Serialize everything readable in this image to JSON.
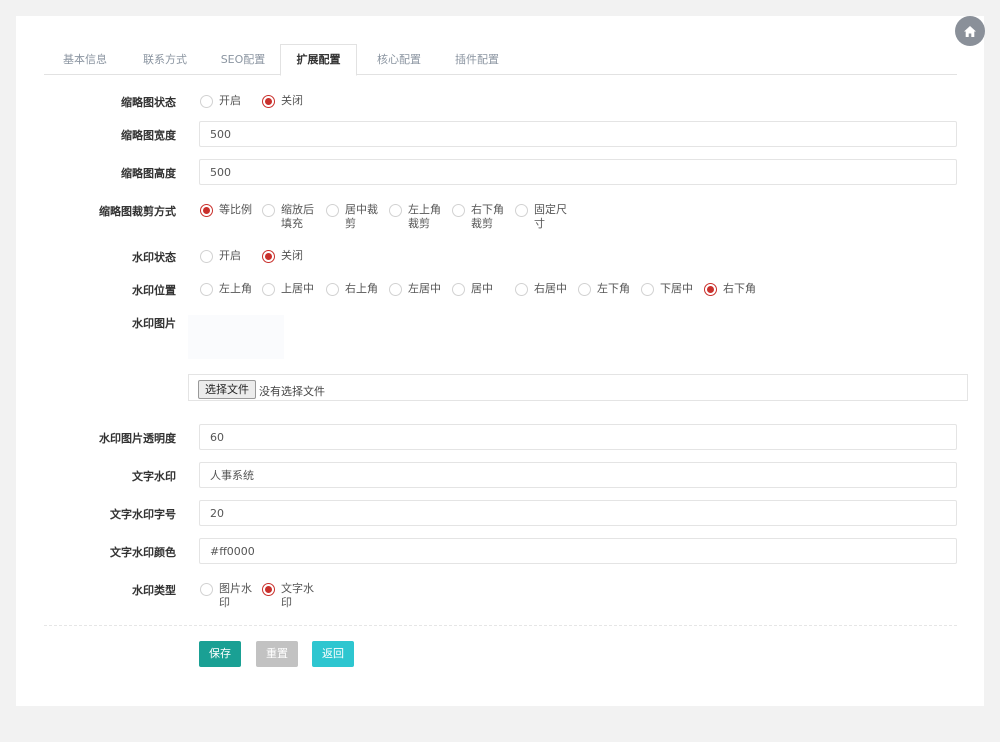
{
  "tabs": [
    "基本信息",
    "联系方式",
    "SEO配置",
    "扩展配置",
    "核心配置",
    "插件配置"
  ],
  "active_tab": 3,
  "form": {
    "thumb_status": {
      "label": "缩略图状态",
      "options": [
        "开启",
        "关闭"
      ],
      "selected": 1
    },
    "thumb_width": {
      "label": "缩略图宽度",
      "value": "500"
    },
    "thumb_height": {
      "label": "缩略图高度",
      "value": "500"
    },
    "thumb_crop": {
      "label": "缩略图裁剪方式",
      "options": [
        "等比例",
        "缩放后填充",
        "居中裁剪",
        "左上角裁剪",
        "右下角裁剪",
        "固定尺寸"
      ],
      "selected": 0
    },
    "watermark_status": {
      "label": "水印状态",
      "options": [
        "开启",
        "关闭"
      ],
      "selected": 1
    },
    "watermark_position": {
      "label": "水印位置",
      "options": [
        "左上角",
        "上居中",
        "右上角",
        "左居中",
        "居中",
        "右居中",
        "左下角",
        "下居中",
        "右下角"
      ],
      "selected": 8
    },
    "watermark_image": {
      "label": "水印图片",
      "button": "选择文件",
      "status": "没有选择文件"
    },
    "watermark_opacity": {
      "label": "水印图片透明度",
      "value": "60"
    },
    "text_watermark": {
      "label": "文字水印",
      "value": "人事系统"
    },
    "text_size": {
      "label": "文字水印字号",
      "value": "20"
    },
    "text_color": {
      "label": "文字水印颜色",
      "value": "#ff0000"
    },
    "watermark_type": {
      "label": "水印类型",
      "options": [
        "图片水印",
        "文字水印"
      ],
      "selected": 1
    }
  },
  "buttons": {
    "save": "保存",
    "reset": "重置",
    "back": "返回"
  },
  "colors": {
    "save": "#1aa094",
    "reset": "#c2c2c2",
    "back": "#2ec6d0",
    "radio_checked": "#c9302c"
  }
}
